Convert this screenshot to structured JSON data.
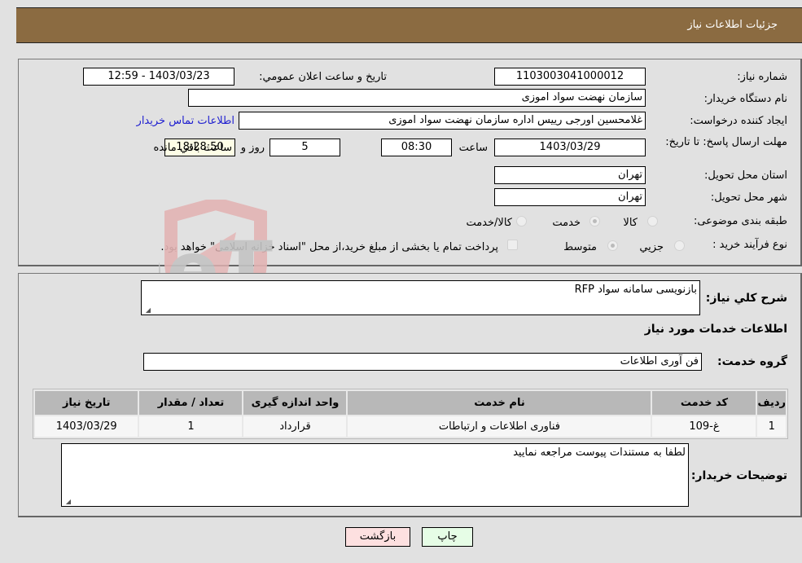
{
  "header": {
    "title": "جزئیات اطلاعات نیاز"
  },
  "form": {
    "need_number": {
      "label": "شماره نیاز:",
      "value": "1103003041000012"
    },
    "announce_datetime": {
      "label": "تاریخ و ساعت اعلان عمومي:",
      "value": "1403/03/23 - 12:59"
    },
    "buyer_org": {
      "label": "نام دستگاه خريدار:",
      "value": "سازمان نهضت سواد اموزی"
    },
    "requester": {
      "label": "ایجاد کننده درخواست:",
      "value": "غلامحسين اورجی رييس اداره سازمان نهضت سواد اموزی"
    },
    "buyer_contact_link": "اطلاعات تماس خريدار",
    "deadline": {
      "label": "مهلت ارسال پاسخ: تا تاریخ:",
      "date": "1403/03/29",
      "time_label": "ساعت",
      "time": "08:30",
      "days": "5",
      "days_label": "روز و",
      "remaining": "18:28:50",
      "remaining_label": "ساعت باقي مانده"
    },
    "province": {
      "label": "استان محل تحویل:",
      "value": "تهران"
    },
    "city": {
      "label": "شهر محل تحویل:",
      "value": "تهران"
    },
    "category": {
      "label": "طبقه بندی موضوعی:",
      "options": [
        "کالا",
        "خدمت",
        "کالا/خدمت"
      ],
      "selected": "خدمت"
    },
    "purchase_type": {
      "label": "نوع فرآیند خرید :",
      "options": [
        "جزيي",
        "متوسط"
      ],
      "selected": "متوسط",
      "treasury_note": "پرداخت تمام یا بخشی از مبلغ خرید،از محل \"اسناد خزانه اسلامی\" خواهد بود.",
      "treasury_checked": false
    }
  },
  "details": {
    "general_desc_label": "شرح کلي نياز:",
    "general_desc": "بازنویسی سامانه سواد RFP",
    "services_heading": "اطلاعات خدمات مورد نياز",
    "service_group_label": "گروه خدمت:",
    "service_group": "فن آوری اطلاعات",
    "table": {
      "headers": [
        "رديف",
        "کد خدمت",
        "نام خدمت",
        "واحد اندازه گیری",
        "تعداد / مقدار",
        "تاريخ نياز"
      ],
      "rows": [
        [
          "1",
          "غ-109",
          "فناوری اطلاعات و ارتباطات",
          "قرارداد",
          "1",
          "1403/03/29"
        ]
      ]
    },
    "buyer_notes_label": "توضيحات خريدار:",
    "buyer_notes": "لطفا به مستندات پیوست مراجعه نمایید"
  },
  "buttons": {
    "print": "چاپ",
    "back": "بازگشت"
  },
  "watermark": {
    "text": "AriaTender.neT"
  }
}
